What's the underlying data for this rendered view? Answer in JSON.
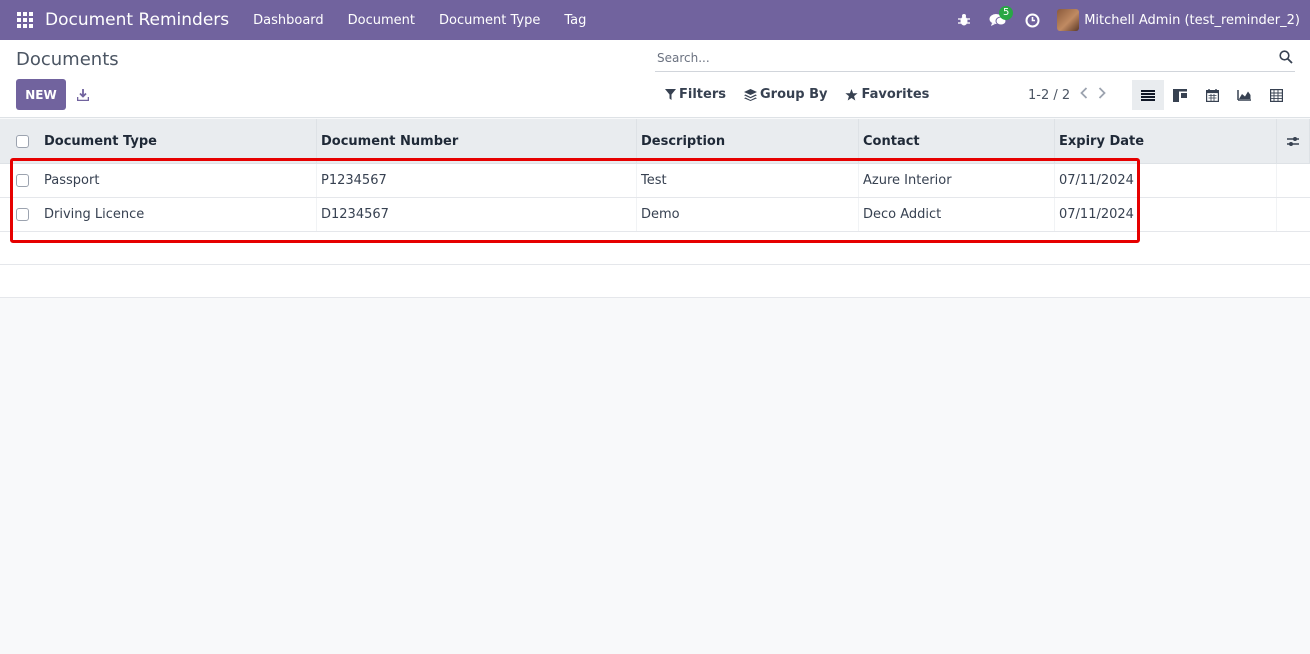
{
  "navbar": {
    "app_title": "Document Reminders",
    "menu": [
      "Dashboard",
      "Document",
      "Document Type",
      "Tag"
    ],
    "messages_count": "5",
    "user_name": "Mitchell Admin (test_reminder_2)",
    "bg_color": "#71639e"
  },
  "control": {
    "page_title": "Documents",
    "new_label": "NEW",
    "search_placeholder": "Search...",
    "filters_label": "Filters",
    "group_by_label": "Group By",
    "favorites_label": "Favorites",
    "pager": "1-2 / 2",
    "views": [
      "list-icon",
      "kanban-icon",
      "calendar-icon",
      "graph-icon",
      "pivot-icon"
    ]
  },
  "table": {
    "columns": [
      "Document Type",
      "Document Number",
      "Description",
      "Contact",
      "Expiry Date"
    ],
    "rows": [
      {
        "type": "Passport",
        "number": "P1234567",
        "description": "Test",
        "contact": "Azure Interior",
        "expiry": "07/11/2024"
      },
      {
        "type": "Driving Licence",
        "number": "D1234567",
        "description": "Demo",
        "contact": "Deco Addict",
        "expiry": "07/11/2024"
      }
    ]
  },
  "colors": {
    "accent": "#71639e",
    "highlight": "#e60000"
  }
}
